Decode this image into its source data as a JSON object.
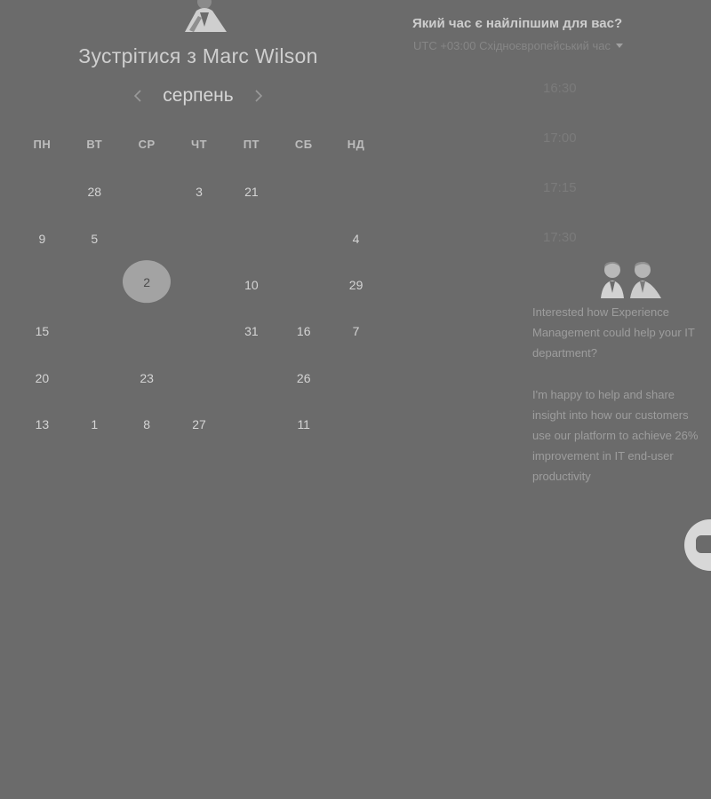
{
  "header": {
    "title": "Зустрітися з Marc Wilson"
  },
  "calendar": {
    "month": "серпень",
    "prev_icon": "chevron-left-icon",
    "next_icon": "chevron-right-icon",
    "weekdays": [
      "ПН",
      "ВТ",
      "СР",
      "ЧТ",
      "ПТ",
      "СБ",
      "НД"
    ],
    "weeks": [
      [
        {
          "label": "",
          "state": "empty"
        },
        {
          "label": "28",
          "state": "available"
        },
        {
          "label": "",
          "state": "empty"
        },
        {
          "label": "3",
          "state": "available"
        },
        {
          "label": "21",
          "state": "available"
        },
        {
          "label": "",
          "state": "empty"
        },
        {
          "label": "",
          "state": "empty"
        }
      ],
      [
        {
          "label": "9",
          "state": "available"
        },
        {
          "label": "5",
          "state": "available"
        },
        {
          "label": "",
          "state": "empty"
        },
        {
          "label": "",
          "state": "empty"
        },
        {
          "label": "",
          "state": "empty"
        },
        {
          "label": "",
          "state": "empty"
        },
        {
          "label": "4",
          "state": "available"
        }
      ],
      [
        {
          "label": "",
          "state": "empty"
        },
        {
          "label": "",
          "state": "empty"
        },
        {
          "label": "2",
          "state": "selected"
        },
        {
          "label": "",
          "state": "empty"
        },
        {
          "label": "10",
          "state": "available"
        },
        {
          "label": "",
          "state": "empty"
        },
        {
          "label": "29",
          "state": "available"
        }
      ],
      [
        {
          "label": "15",
          "state": "available"
        },
        {
          "label": "",
          "state": "empty"
        },
        {
          "label": "",
          "state": "empty"
        },
        {
          "label": "",
          "state": "empty"
        },
        {
          "label": "31",
          "state": "available"
        },
        {
          "label": "16",
          "state": "available"
        },
        {
          "label": "7",
          "state": "available"
        }
      ],
      [
        {
          "label": "20",
          "state": "available"
        },
        {
          "label": "",
          "state": "empty"
        },
        {
          "label": "23",
          "state": "available"
        },
        {
          "label": "",
          "state": "empty"
        },
        {
          "label": "",
          "state": "empty"
        },
        {
          "label": "26",
          "state": "available"
        },
        {
          "label": "",
          "state": "empty"
        }
      ],
      [
        {
          "label": "13",
          "state": "available"
        },
        {
          "label": "1",
          "state": "available"
        },
        {
          "label": "8",
          "state": "available"
        },
        {
          "label": "27",
          "state": "available"
        },
        {
          "label": "",
          "state": "empty"
        },
        {
          "label": "11",
          "state": "available"
        },
        {
          "label": "",
          "state": "empty"
        }
      ]
    ]
  },
  "time_picker": {
    "heading": "Який час є найліпшим для вас?",
    "timezone": "UTC +03:00 Східноєвропейський час",
    "timezone_icon": "caret-down-icon",
    "slots": [
      "16:30",
      "17:00",
      "17:15",
      "17:30"
    ]
  },
  "promo": {
    "paragraph1": [
      "Interested how Experience",
      "Management could help your IT",
      "department?"
    ],
    "paragraph2": [
      "I'm happy to help and share",
      "insight into how our customers",
      "use our platform to achieve 26%",
      "improvement in IT end-user",
      "productivity"
    ]
  },
  "colors": {
    "overlay_background": "#6b6b6b",
    "selected_day": "#a3a3a3",
    "text_primary": "#d4d4d4",
    "text_muted": "#7b7b7b"
  }
}
